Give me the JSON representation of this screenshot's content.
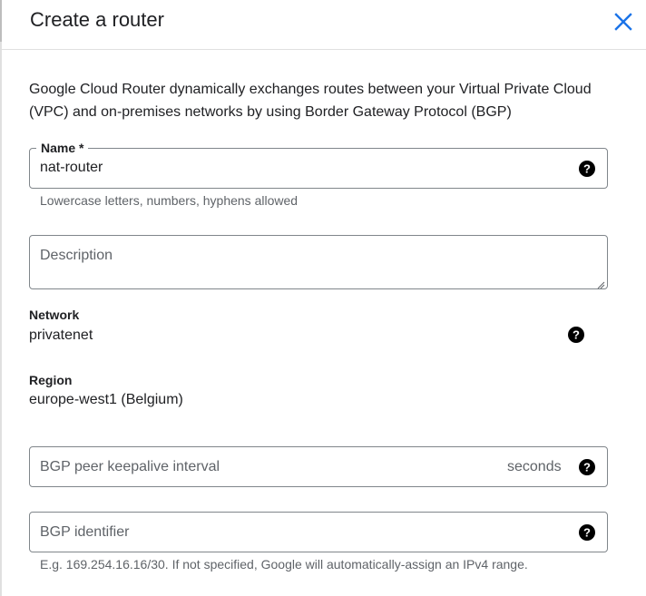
{
  "dialog": {
    "title": "Create a router",
    "close_icon": "close-icon",
    "description": "Google Cloud Router dynamically exchanges routes between your Virtual Private Cloud (VPC) and on-premises networks by using Border Gateway Protocol (BGP)"
  },
  "form": {
    "name": {
      "label": "Name *",
      "value": "nat-router",
      "hint": "Lowercase letters, numbers, hyphens allowed",
      "icon": "help-icon"
    },
    "description": {
      "placeholder": "Description",
      "value": ""
    },
    "network": {
      "label": "Network",
      "value": "privatenet",
      "icon": "help-icon"
    },
    "region": {
      "label": "Region",
      "value": "europe-west1 (Belgium)"
    },
    "bgp_keepalive": {
      "placeholder": "BGP peer keepalive interval",
      "suffix": "seconds",
      "value": "",
      "icon": "help-icon"
    },
    "bgp_identifier": {
      "placeholder": "BGP identifier",
      "value": "",
      "hint": "E.g. 169.254.16.16/30. If not specified, Google will automatically-assign an IPv4 range.",
      "icon": "help-icon"
    }
  },
  "colors": {
    "close_icon": "#1a73e8",
    "border": "#80868b",
    "secondary_text": "#5f6368"
  }
}
